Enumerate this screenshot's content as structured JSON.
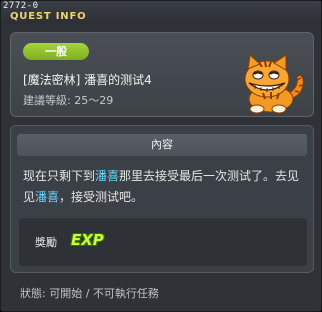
{
  "window": {
    "quest_id": "2772-0",
    "title": "QUEST INFO"
  },
  "header": {
    "category": "一般",
    "quest_name": "[魔法密林] 潘喜的测试4",
    "level_text": "建議等級: 25～29",
    "npc_portrait_icon": "orange-tabby-cat-portrait"
  },
  "content": {
    "header": "內容",
    "segments": [
      "现在只剩下到",
      "潘喜",
      "那里去接受最后一次测试了。去见见",
      "潘喜",
      "，接受测试吧。"
    ],
    "npc_name_color": "#66d8ff"
  },
  "reward": {
    "label": "獎勵",
    "item": "EXP",
    "item_icon": "exp-icon"
  },
  "status": {
    "text": "狀態: 可開始 / 不可執行任務"
  }
}
